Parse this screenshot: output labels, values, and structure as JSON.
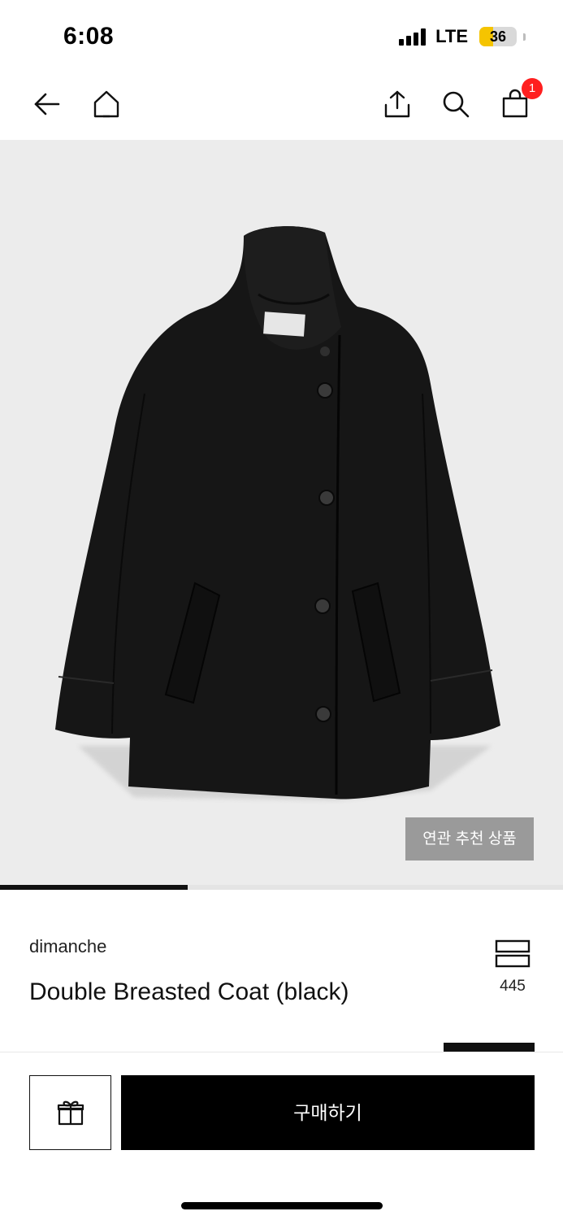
{
  "status_bar": {
    "time": "6:08",
    "network": "LTE",
    "battery_level": "36",
    "battery_fraction": 0.36,
    "battery_color": "#f5c400"
  },
  "nav": {
    "back_icon": "arrow-left-icon",
    "home_icon": "home-icon",
    "share_icon": "share-icon",
    "search_icon": "search-icon",
    "cart_icon": "shopping-bag-icon",
    "cart_badge": "1",
    "badge_color": "#ff1f1f"
  },
  "product_image": {
    "background_color": "#ececec",
    "related_button_label": "연관 추천 상품",
    "carousel_progress": 0.333
  },
  "product": {
    "brand": "dimanche",
    "name": "Double Breasted Coat (black)",
    "rank_icon": "ranking-stack-icon",
    "rank_count": "445"
  },
  "bottom_bar": {
    "gift_icon": "gift-icon",
    "buy_label": "구매하기"
  }
}
